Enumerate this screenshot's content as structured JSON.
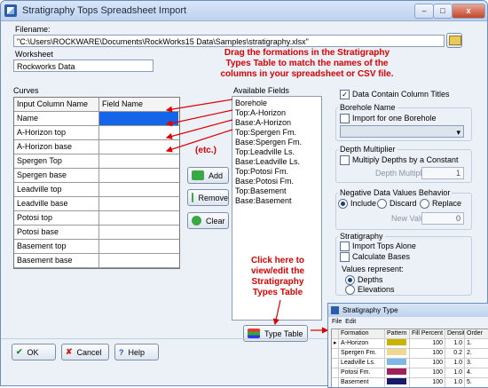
{
  "window": {
    "title": "Stratigraphy Tops Spreadsheet Import",
    "close_label": "x"
  },
  "filename": {
    "label": "Filename:",
    "value": "\"C:\\Users\\ROCKWARE\\Documents\\RockWorks15 Data\\Samples\\stratigraphy.xlsx\""
  },
  "worksheet": {
    "label": "Worksheet",
    "value": "Rockworks Data"
  },
  "annotations": {
    "drag": [
      "Drag the formations in the Stratigraphy",
      "Types Table to match the names of the",
      "columns in your spreadsheet or CSV file."
    ],
    "etc": "(etc.)",
    "click": [
      "Click here to",
      "view/edit the",
      "Stratigraphy",
      "Types Table"
    ]
  },
  "curves": {
    "label": "Curves",
    "headers": [
      "Input Column Name",
      "Field Name"
    ],
    "rows": [
      "Name",
      "A-Horizon top",
      "A-Horizon base",
      "Spergen Top",
      "Spergen base",
      "Leadville top",
      "Leadville base",
      "Potosi top",
      "Potosi base",
      "Basement top",
      "Basement base"
    ]
  },
  "available_fields": {
    "label": "Available Fields",
    "items": [
      "Borehole",
      "Top:A-Horizon",
      "Base:A-Horizon",
      "Top:Spergen Fm.",
      "Base:Spergen Fm.",
      "Top:Leadville Ls.",
      "Base:Leadville Ls.",
      "Top:Potosi Fm.",
      "Base:Potosi Fm.",
      "Top:Basement",
      "Base:Basement"
    ]
  },
  "buttons": {
    "add": "Add",
    "remove": "Remove",
    "clear": "Clear",
    "type_table": "Type Table",
    "ok": "OK",
    "cancel": "Cancel",
    "help": "Help"
  },
  "options": {
    "column_titles": "Data Contain Column Titles",
    "borehole_name": {
      "title": "Borehole Name",
      "import_one": "Import for one Borehole"
    },
    "depth_multiplier": {
      "title": "Depth Multiplier",
      "multiply": "Multiply Depths by a Constant",
      "field_label": "Depth Multiplier:",
      "value": "1"
    },
    "negative": {
      "title": "Negative Data Values Behavior",
      "include": "Include",
      "discard": "Discard",
      "replace": "Replace",
      "new_value_label": "New Value:",
      "new_value": "0"
    },
    "stratigraphy": {
      "title": "Stratigraphy",
      "import_tops_alone": "Import Tops Alone",
      "calculate_bases": "Calculate Bases",
      "values_represent": "Values represent:",
      "depths": "Depths",
      "elevations": "Elevations"
    }
  },
  "popup": {
    "title": "Stratigraphy Type",
    "menu": [
      "File",
      "Edit"
    ],
    "headers": [
      "Formation",
      "Pattern",
      "Fill Percent",
      "Density",
      "Order"
    ],
    "rows": [
      {
        "name": "A-Horizon",
        "color": "#c8b400",
        "fill": "100",
        "density": "1.0",
        "order": "1."
      },
      {
        "name": "Spergen Fm.",
        "color": "#f0d890",
        "fill": "100",
        "density": "0.2",
        "order": "2."
      },
      {
        "name": "Leadville Ls.",
        "color": "#7fb7e6",
        "fill": "100",
        "density": "1.0",
        "order": "3."
      },
      {
        "name": "Potosi Fm.",
        "color": "#a0205a",
        "fill": "100",
        "density": "1.0",
        "order": "4."
      },
      {
        "name": "Basement",
        "color": "#1a1a6a",
        "fill": "100",
        "density": "1.0",
        "order": "5."
      }
    ]
  },
  "colors": {
    "annotation": "#e00000",
    "selection": "#1565e8"
  }
}
